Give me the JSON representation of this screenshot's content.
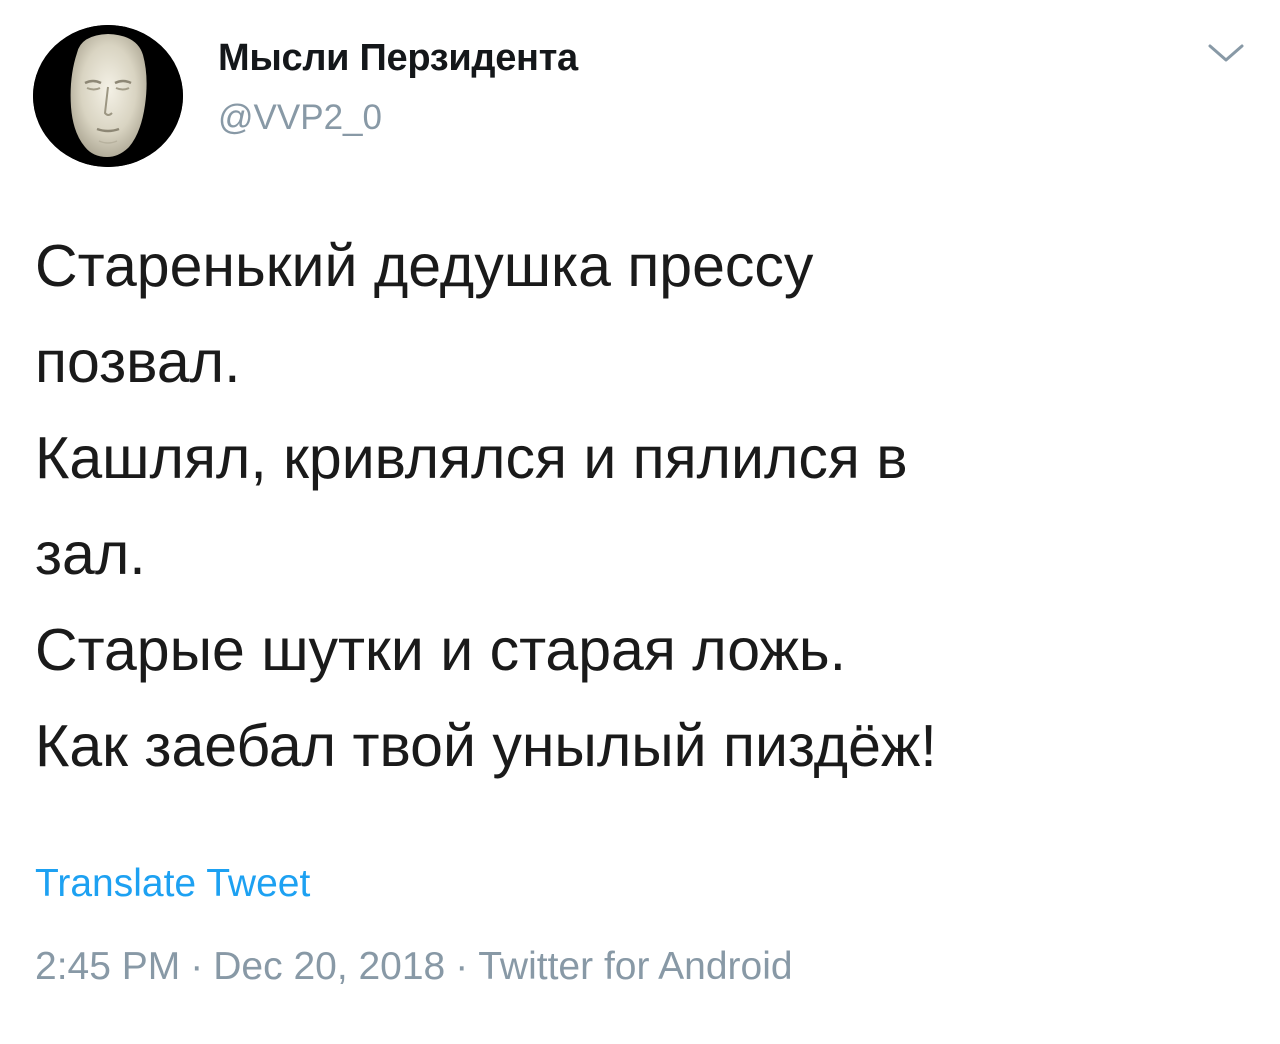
{
  "author": {
    "display_name": "Мысли Перзидента",
    "handle": "@VVP2_0",
    "avatar_icon": "death-mask-avatar"
  },
  "menu": {
    "icon": "chevron-down-icon"
  },
  "tweet": {
    "lines": [
      "Старенький дедушка прессу",
      "позвал.",
      "Кашлял, кривлялся и пялился в",
      "зал.",
      "Старые шутки и старая ложь.",
      "Как заебал твой унылый пиздёж!"
    ]
  },
  "translate_label": "Translate Tweet",
  "meta": {
    "time": "2:45 PM",
    "separator": "·",
    "date": "Dec 20, 2018",
    "source": "Twitter for Android"
  },
  "colors": {
    "link": "#1da1f2",
    "secondary_text": "#8899a6",
    "primary_text": "#14171a"
  }
}
